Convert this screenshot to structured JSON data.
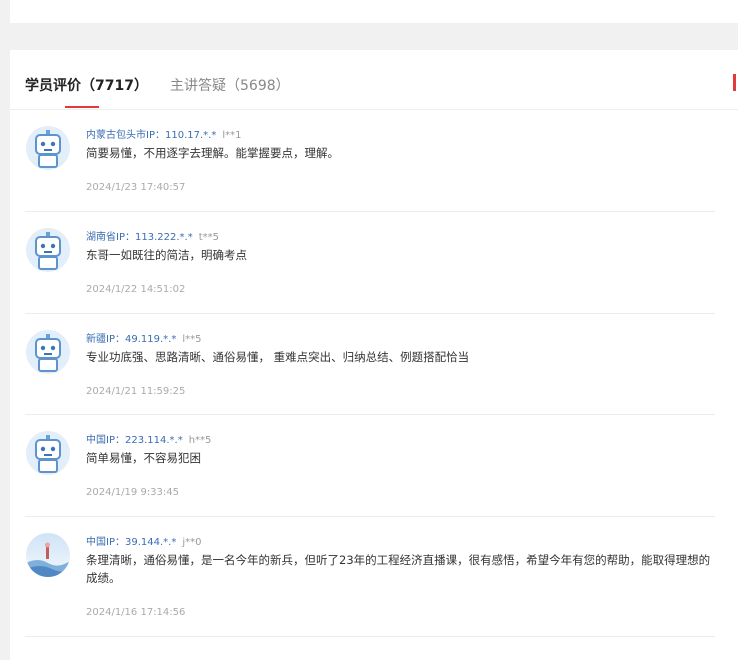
{
  "tabs": {
    "reviews_label": "学员评价（7717）",
    "qa_label": "主讲答疑（5698）"
  },
  "reviews": [
    {
      "location": "内蒙古包头市IP：110.17.*.*",
      "user": "l**1",
      "content": "简要易懂，不用逐字去理解。能掌握要点，理解。",
      "time": "2024/1/23 17:40:57",
      "avatar": "robot-avatar"
    },
    {
      "location": "湖南省IP：113.222.*.*",
      "user": "t**5",
      "content": "东哥一如既往的简洁，明确考点",
      "time": "2024/1/22 14:51:02",
      "avatar": "robot-avatar"
    },
    {
      "location": "新疆IP：49.119.*.*",
      "user": "l**5",
      "content": "专业功底强、思路清晰、通俗易懂， 重难点突出、归纳总结、例题搭配恰当",
      "time": "2024/1/21 11:59:25",
      "avatar": "robot-avatar"
    },
    {
      "location": "中国IP：223.114.*.*",
      "user": "h**5",
      "content": "简单易懂，不容易犯困",
      "time": "2024/1/19 9:33:45",
      "avatar": "robot-avatar"
    },
    {
      "location": "中国IP：39.144.*.*",
      "user": "j**0",
      "content": "条理清晰，通俗易懂，是一名今年的新兵，但听了23年的工程经济直播课，很有感悟，希望今年有您的帮助，能取得理想的成绩。",
      "time": "2024/1/16 17:14:56",
      "avatar": "landscape-avatar"
    }
  ],
  "colors": {
    "accent": "#e4393c",
    "link": "#3a6db3"
  }
}
